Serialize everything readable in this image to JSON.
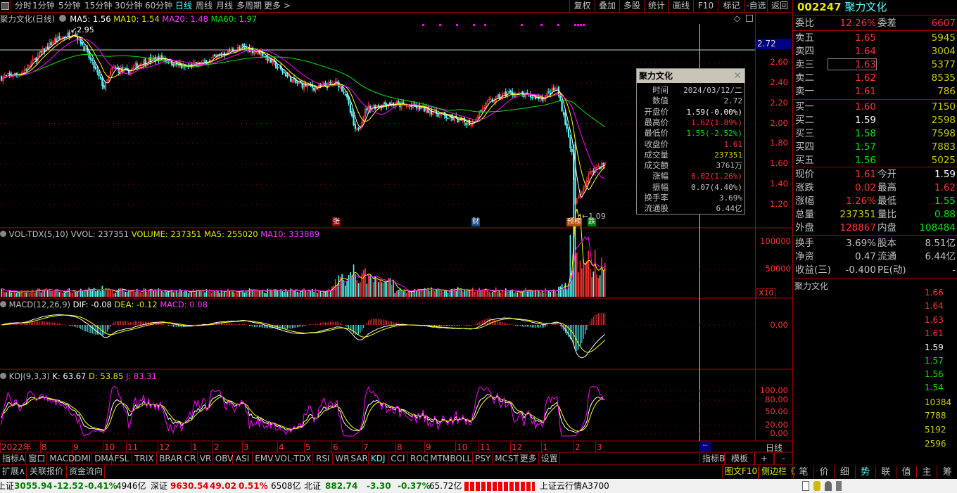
{
  "colors": {
    "up": "#ff3232",
    "down": "#54fcfc",
    "ma5": "#ffffff",
    "ma10": "#ffff00",
    "ma20": "#ff00ff",
    "ma60": "#00e600",
    "frame": "#a00000"
  },
  "toolbar": {
    "periods": [
      "分时",
      "1分钟",
      "5分钟",
      "15分钟",
      "30分钟",
      "60分钟",
      "日线",
      "周线",
      "月线",
      "多周期",
      "更多 >"
    ],
    "active_period": "日线",
    "buttons": [
      "复权",
      "叠加",
      "多股",
      "统计",
      "画线",
      "F10",
      "标记",
      "-自选",
      "返回"
    ]
  },
  "main": {
    "title": "聚力文化(日线)",
    "ma5": "MA5: 1.56",
    "ma10": "MA10: 1.54",
    "ma20": "MA20: 1.48",
    "ma60": "MA60: 1.97",
    "high_mark": "2.95",
    "low_mark": "1.09",
    "crosshair_value": "2.72",
    "price_ticks": [
      "2.60",
      "2.40",
      "2.20",
      "2.00",
      "1.80",
      "1.60",
      "1.40",
      "1.20"
    ],
    "events": [
      {
        "label": "张",
        "color": "#8b0000"
      },
      {
        "label": "财",
        "color": "#1a4a8a"
      },
      {
        "label": "预榜",
        "color": "#b04a00"
      },
      {
        "label": "跌",
        "color": "#007a00"
      }
    ]
  },
  "chart_data": {
    "type": "candlestick",
    "ylim": [
      1.09,
      2.95
    ],
    "y_ticks": [
      1.2,
      1.4,
      1.6,
      1.8,
      2.0,
      2.2,
      2.4,
      2.6
    ],
    "approx_close_path": [
      [
        "2022-06-20",
        2.45
      ],
      [
        "2022-07-12",
        2.5
      ],
      [
        "2022-08-02",
        2.7
      ],
      [
        "2022-08-13",
        2.8
      ],
      [
        "2022-09-04",
        2.9
      ],
      [
        "2022-09-12",
        2.8
      ],
      [
        "2022-09-23",
        2.6
      ],
      [
        "2022-10-06",
        2.35
      ],
      [
        "2022-10-15",
        2.55
      ],
      [
        "2022-10-30",
        2.5
      ],
      [
        "2022-11-13",
        2.6
      ],
      [
        "2022-12-05",
        2.65
      ],
      [
        "2022-12-27",
        2.55
      ],
      [
        "2023-01-18",
        2.6
      ],
      [
        "2023-02-09",
        2.7
      ],
      [
        "2023-02-27",
        2.75
      ],
      [
        "2023-03-18",
        2.7
      ],
      [
        "2023-04-05",
        2.55
      ],
      [
        "2023-04-23",
        2.4
      ],
      [
        "2023-05-15",
        2.35
      ],
      [
        "2023-06-06",
        2.4
      ],
      [
        "2023-06-14",
        2.3
      ],
      [
        "2023-06-25",
        1.9
      ],
      [
        "2023-07-06",
        2.15
      ],
      [
        "2023-07-28",
        2.2
      ],
      [
        "2023-09-03",
        2.15
      ],
      [
        "2023-10-02",
        2.05
      ],
      [
        "2023-10-23",
        2.0
      ],
      [
        "2023-11-08",
        2.2
      ],
      [
        "2023-11-30",
        2.3
      ],
      [
        "2024-01-05",
        2.25
      ],
      [
        "2024-01-20",
        2.35
      ],
      [
        "2024-01-27",
        2.1
      ],
      [
        "2024-02-05",
        1.7
      ],
      [
        "2024-02-08",
        1.2
      ],
      [
        "2024-02-26",
        1.55
      ],
      [
        "2024-03-12",
        1.61
      ]
    ]
  },
  "x_axis": {
    "labels": [
      "2022年",
      "8",
      "9",
      "10",
      "11",
      "12",
      "1",
      "2",
      "3",
      "4",
      "5",
      "6",
      "7",
      "8",
      "9",
      "10",
      "11",
      "12",
      "1",
      "2",
      "3"
    ],
    "period_label": "日线",
    "cursor": "--"
  },
  "volume": {
    "title": "VOL-TDX(5,10)",
    "vvol": "VVOL: 237351",
    "volume": "VOLUME: 237351",
    "ma5": "MA5: 255020",
    "ma10": "MA10: 333889",
    "ticks": [
      "100000",
      "50000"
    ],
    "unit": "X10"
  },
  "macd": {
    "title": "MACD(12,26,9)",
    "dif": "DIF: -0.08",
    "dea": "DEA: -0.12",
    "macd": "MACD: 0.08",
    "ticks": [
      "0.00"
    ]
  },
  "kdj": {
    "title": "KDJ(9,3,3)",
    "k": "K: 63.67",
    "d": "D: 53.85",
    "j": "J: 83.31",
    "ticks": [
      "100.00",
      "80.00",
      "50.00",
      "20.00",
      "0.00"
    ]
  },
  "popup": {
    "title": "聚力文化",
    "rows": [
      [
        "时间",
        "2024/03/12/二",
        "gry"
      ],
      [
        "数值",
        "2.72",
        "gry"
      ],
      [
        "开盘价",
        "1.59(-0.00%)",
        "wht"
      ],
      [
        "最高价",
        "1.62(1.89%)",
        "red"
      ],
      [
        "最低价",
        "1.55(-2.52%)",
        "grn"
      ],
      [
        "收盘价",
        "1.61",
        "red"
      ],
      [
        "成交量",
        "237351",
        "ylw"
      ],
      [
        "成交额",
        "3761万",
        "gry"
      ],
      [
        "涨幅",
        "0.02(1.26%)",
        "red"
      ],
      [
        "振幅",
        "0.07(4.40%)",
        "gry"
      ],
      [
        "换手率",
        "3.69%",
        "gry"
      ],
      [
        "流通股",
        "6.44亿",
        "gry"
      ]
    ]
  },
  "quote": {
    "code": "002247",
    "name": "聚力文化",
    "weibi_label": "委比",
    "weibi": "12.26%",
    "weicha_label": "委差",
    "weicha": "6607",
    "sell": [
      [
        "卖五",
        "1.65",
        "5945"
      ],
      [
        "卖四",
        "1.64",
        "3004"
      ],
      [
        "卖三",
        "1.63",
        "5377"
      ],
      [
        "卖二",
        "1.62",
        "8535"
      ],
      [
        "卖一",
        "1.61",
        "786"
      ]
    ],
    "buy": [
      [
        "买一",
        "1.60",
        "7150",
        "red"
      ],
      [
        "买二",
        "1.59",
        "2598",
        "wht"
      ],
      [
        "买三",
        "1.58",
        "7598",
        "grn"
      ],
      [
        "买四",
        "1.57",
        "7883",
        "grn"
      ],
      [
        "买五",
        "1.56",
        "5025",
        "grn"
      ]
    ],
    "stats": [
      [
        "现价",
        "1.61",
        "red",
        "今开",
        "1.59",
        "wht"
      ],
      [
        "涨跌",
        "0.02",
        "red",
        "最高",
        "1.62",
        "red"
      ],
      [
        "涨幅",
        "1.26%",
        "red",
        "最低",
        "1.55",
        "grn"
      ],
      [
        "总量",
        "237351",
        "ylw",
        "量比",
        "0.88",
        "grn"
      ],
      [
        "外盘",
        "128867",
        "red",
        "内盘",
        "108484",
        "grn"
      ]
    ],
    "fund": [
      [
        "换手",
        "3.69%",
        "股本",
        "8.51亿"
      ],
      [
        "净资",
        "0.47",
        "流通",
        "6.44亿"
      ],
      [
        "收益(三)",
        "-0.400",
        "PE(动)",
        "-"
      ]
    ]
  },
  "intraday": {
    "title": "聚力文化",
    "price_ticks": [
      [
        "1.66",
        "red"
      ],
      [
        "1.64",
        "red"
      ],
      [
        "1.63",
        "red"
      ],
      [
        "1.61",
        "red"
      ],
      [
        "1.59",
        "wht"
      ],
      [
        "1.57",
        "grn"
      ],
      [
        "1.56",
        "grn"
      ],
      [
        "1.54",
        "grn"
      ]
    ],
    "vol_ticks": [
      "10384",
      "7788",
      "5192",
      "2596"
    ]
  },
  "indicator_tabs": [
    "指标A",
    "窗口",
    "MACD",
    "DMI",
    "DMA",
    "FSL",
    "TRIX",
    "BRAR",
    "CR",
    "VR",
    "OBV",
    "ASI",
    "EMV",
    "VOL-TDX",
    "RSI",
    "WR",
    "SAR",
    "KDJ",
    "CCI",
    "ROC",
    "MTM",
    "BOLL",
    "PSY",
    "MCST",
    "更多",
    "设置"
  ],
  "active_indicator": "KDJ",
  "right_tabs": [
    "指标B",
    "模板",
    "+",
    "-"
  ],
  "ext_tabs": [
    "扩展∧",
    "关联报价",
    "资金流向"
  ],
  "side_links": [
    "图文F10",
    "侧边栏《"
  ],
  "panel_tabs": [
    "笔",
    "价",
    "细",
    "势",
    "联",
    "值",
    "主",
    "筹"
  ],
  "active_panel_tab": "势",
  "status": {
    "sh_label": "上证",
    "sh": "3055.94",
    "sh_chg": "-12.52",
    "sh_pct": "-0.41%",
    "sh_amt": "4946亿",
    "sz_label": "深证",
    "sz": "9630.54",
    "sz_chg": "49.02",
    "sz_pct": "0.51%",
    "sz_amt": "6508亿",
    "bj_label": "北证",
    "bj": "882.74",
    "bj_chg": "-3.30",
    "bj_pct": "-0.37%",
    "bj_amt": "65.72亿",
    "server": "上证云行情A3700"
  }
}
